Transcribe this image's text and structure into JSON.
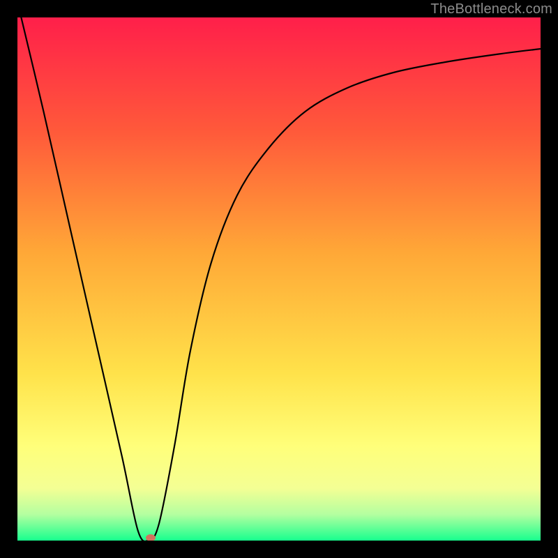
{
  "watermark": "TheBottleneck.com",
  "chart_data": {
    "type": "line",
    "title": "",
    "xlabel": "",
    "ylabel": "",
    "xlim": [
      0,
      100
    ],
    "ylim": [
      0,
      100
    ],
    "grid": false,
    "legend": false,
    "background_gradient": {
      "stops": [
        {
          "pos": 0.0,
          "color": "#ff1f4a"
        },
        {
          "pos": 0.22,
          "color": "#ff5a3a"
        },
        {
          "pos": 0.45,
          "color": "#ffa837"
        },
        {
          "pos": 0.68,
          "color": "#ffe24a"
        },
        {
          "pos": 0.82,
          "color": "#ffff7a"
        },
        {
          "pos": 0.9,
          "color": "#f4ff94"
        },
        {
          "pos": 0.95,
          "color": "#b4ffa0"
        },
        {
          "pos": 1.0,
          "color": "#18ff8e"
        }
      ]
    },
    "series": [
      {
        "name": "bottleneck-curve",
        "x": [
          0,
          5,
          10,
          15,
          20,
          23,
          25,
          27,
          30,
          33,
          37,
          42,
          48,
          55,
          63,
          72,
          82,
          92,
          100
        ],
        "y": [
          103,
          82,
          60,
          38,
          16,
          2,
          0,
          3,
          18,
          36,
          53,
          66,
          75,
          82,
          86.5,
          89.5,
          91.5,
          93,
          94
        ],
        "note": "y is in percent of plot height measured from bottom; the sharp V dips to 0 near x≈25 then rises asymptotically toward ~94."
      }
    ],
    "marker": {
      "x": 25.5,
      "y": 0.5,
      "color": "#d2735e"
    }
  }
}
